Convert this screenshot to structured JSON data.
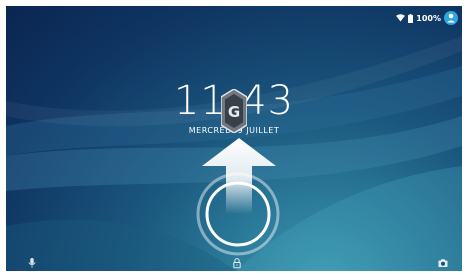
{
  "status_bar": {
    "battery": "100%",
    "icons": [
      "wifi-icon",
      "battery-icon",
      "account-icon"
    ]
  },
  "lockscreen": {
    "time": "11:43",
    "date": "MERCREDI 9 JUILLET"
  },
  "bottom_bar": {
    "icons": [
      "microphone-icon",
      "lock-icon",
      "camera-icon"
    ]
  },
  "colors": {
    "background_dark": "#0b2550",
    "background_light": "#3f9bb3",
    "accent": "#ffffff"
  }
}
